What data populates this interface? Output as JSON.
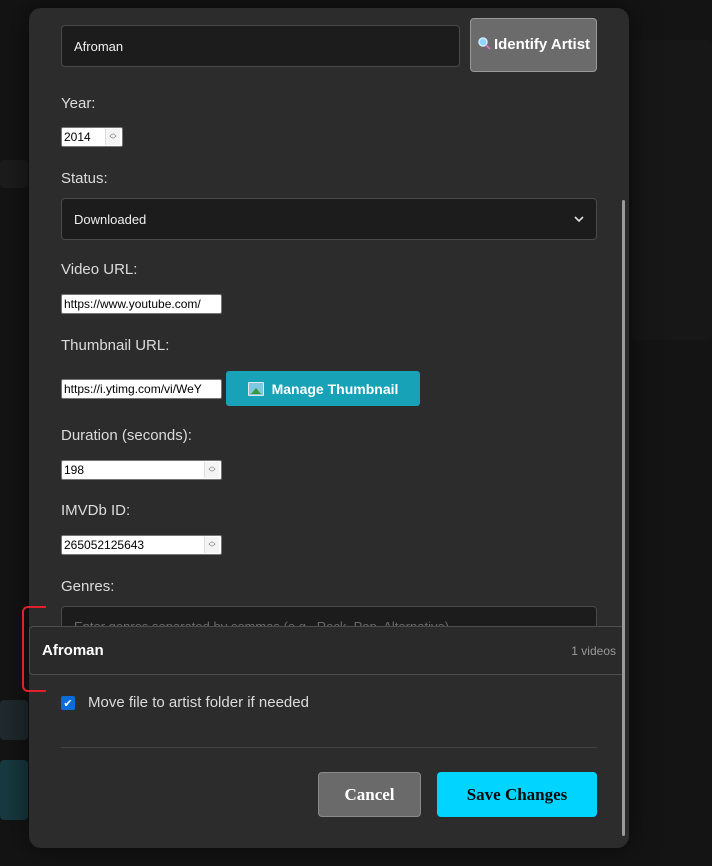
{
  "form": {
    "artist_value": "Afroman",
    "identify_button": {
      "icon": "magnifier-icon",
      "label": "Identify Artist"
    },
    "year_label": "Year:",
    "year_value": "2014",
    "status_label": "Status:",
    "status_value": "Downloaded",
    "video_url_label": "Video URL:",
    "video_url_value": "https://www.youtube.com/",
    "thumbnail_url_label": "Thumbnail URL:",
    "thumbnail_url_value": "https://i.ytimg.com/vi/WeY",
    "manage_thumbnail_button": {
      "icon": "image-icon",
      "label": "Manage Thumbnail"
    },
    "duration_label": "Duration (seconds):",
    "duration_value": "198",
    "imvdb_label": "IMVDb ID:",
    "imvdb_value": "265052125643",
    "genres_label": "Genres:",
    "genres_placeholder": "Enter genres separated by commas (e.g., Rock, Pop, Alternative)",
    "move_file_checked": true,
    "move_file_label": "Move file to artist folder if needed"
  },
  "artist_suggestion": {
    "name": "Afroman",
    "count": "1 videos"
  },
  "footer": {
    "cancel_label": "Cancel",
    "save_label": "Save Changes"
  },
  "colors": {
    "modal_bg": "#2c2c2c",
    "accent_save": "#00d4ff",
    "accent_thumbnail": "#17a2b8",
    "checkbox": "#0a6cd8",
    "annotation_mark": "#e0202a"
  }
}
